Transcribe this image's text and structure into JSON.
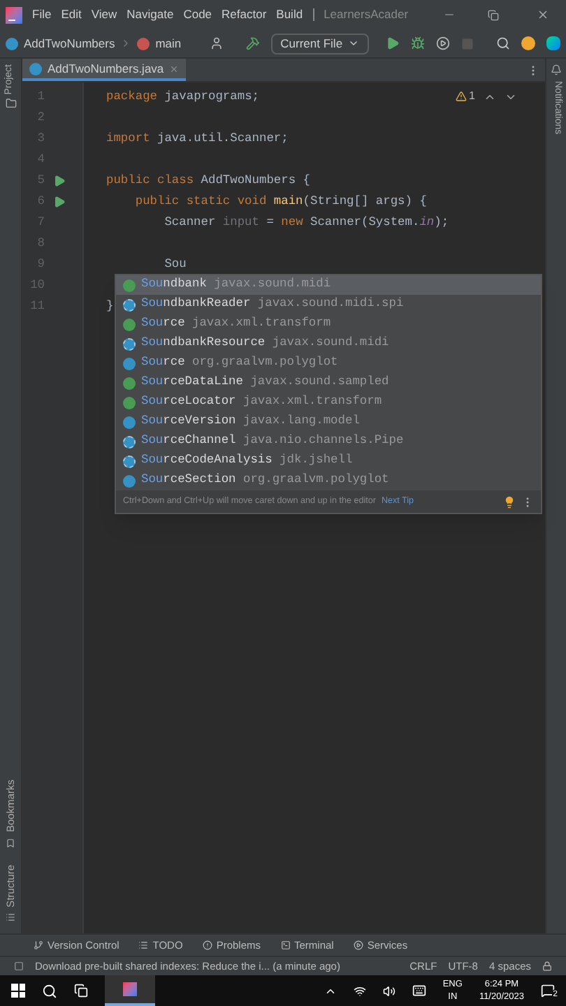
{
  "menu_bar": {
    "items": [
      "File",
      "Edit",
      "View",
      "Navigate",
      "Code",
      "Refactor",
      "Build"
    ],
    "project": "LearnersAcader"
  },
  "toolbar": {
    "breadcrumbs": [
      "AddTwoNumbers",
      "main"
    ],
    "run_config": "Current File"
  },
  "tabs": [
    {
      "label": "AddTwoNumbers.java",
      "selected": true
    }
  ],
  "left_stripe": {
    "top": "Project",
    "bottom": [
      "Bookmarks",
      "Structure"
    ]
  },
  "right_stripe": "Notifications",
  "inspection": {
    "warnings": "1"
  },
  "editor": {
    "lines": [
      {
        "number": "1",
        "run": false,
        "tokens": [
          {
            "text": "package ",
            "kind": "keyword"
          },
          {
            "text": "javaprograms;",
            "kind": "plain"
          }
        ]
      },
      {
        "number": "2",
        "run": false
      },
      {
        "number": "3",
        "run": false,
        "tokens": [
          {
            "text": "import ",
            "kind": "keyword"
          },
          {
            "text": "java.util.Scanner;",
            "kind": "plain"
          }
        ]
      },
      {
        "number": "4",
        "run": false
      },
      {
        "number": "5",
        "run": true,
        "tokens": [
          {
            "text": "public class ",
            "kind": "keyword"
          },
          {
            "text": "AddTwoNumbers {",
            "kind": "plain"
          }
        ]
      },
      {
        "number": "6",
        "run": true,
        "tokens": [
          {
            "text": "    public static void ",
            "kind": "keyword"
          },
          {
            "text": "main",
            "kind": "method"
          },
          {
            "text": "(String[] args) {",
            "kind": "plain"
          }
        ]
      },
      {
        "number": "7",
        "run": false,
        "tokens": [
          {
            "text": "        Scanner ",
            "kind": "plain"
          },
          {
            "text": "input",
            "kind": "unused"
          },
          {
            "text": " = ",
            "kind": "plain"
          },
          {
            "text": "new ",
            "kind": "keyword"
          },
          {
            "text": "Scanner(System.",
            "kind": "plain"
          },
          {
            "text": "in",
            "kind": "field"
          },
          {
            "text": ");",
            "kind": "plain"
          }
        ]
      },
      {
        "number": "8",
        "run": false
      },
      {
        "number": "9",
        "run": false,
        "tokens": [
          {
            "text": "        Sou",
            "kind": "plain"
          }
        ]
      },
      {
        "number": "10",
        "run": false
      },
      {
        "number": "11",
        "run": false,
        "tokens": [
          {
            "text": "}",
            "kind": "plain"
          }
        ]
      }
    ]
  },
  "completion": {
    "items": [
      {
        "kind": "interface",
        "match": "Sou",
        "rest": "ndbank",
        "package": "javax.sound.midi",
        "selected": true
      },
      {
        "kind": "abstract",
        "match": "Sou",
        "rest": "ndbankReader",
        "package": "javax.sound.midi.spi",
        "selected": false
      },
      {
        "kind": "interface",
        "match": "Sou",
        "rest": "rce",
        "package": "javax.xml.transform",
        "selected": false
      },
      {
        "kind": "abstract",
        "match": "Sou",
        "rest": "ndbankResource",
        "package": "javax.sound.midi",
        "selected": false
      },
      {
        "kind": "class",
        "match": "Sou",
        "rest": "rce",
        "package": "org.graalvm.polyglot",
        "selected": false
      },
      {
        "kind": "interface",
        "match": "Sou",
        "rest": "rceDataLine",
        "package": "javax.sound.sampled",
        "selected": false
      },
      {
        "kind": "interface",
        "match": "Sou",
        "rest": "rceLocator",
        "package": "javax.xml.transform",
        "selected": false
      },
      {
        "kind": "class",
        "match": "Sou",
        "rest": "rceVersion",
        "package": "javax.lang.model",
        "selected": false
      },
      {
        "kind": "abstract",
        "match": "Sou",
        "rest": "rceChannel",
        "package": "java.nio.channels.Pipe",
        "selected": false
      },
      {
        "kind": "abstract",
        "match": "Sou",
        "rest": "rceCodeAnalysis",
        "package": "jdk.jshell",
        "selected": false
      },
      {
        "kind": "class",
        "match": "Sou",
        "rest": "rceSection",
        "package": "org.graalvm.polyglot",
        "selected": false
      }
    ],
    "hint": "Ctrl+Down and Ctrl+Up will move caret down and up in the editor",
    "next_tip": "Next Tip"
  },
  "tool_windows": [
    "Version Control",
    "TODO",
    "Problems",
    "Terminal",
    "Services"
  ],
  "status_bar": {
    "message": "Download pre-built shared indexes: Reduce the i... (a minute ago)",
    "line_separator": "CRLF",
    "encoding": "UTF-8",
    "indent": "4 spaces"
  },
  "taskbar": {
    "language": "ENG",
    "region": "IN",
    "time": "6:24 PM",
    "date": "11/20/2023",
    "notifications": "2"
  }
}
